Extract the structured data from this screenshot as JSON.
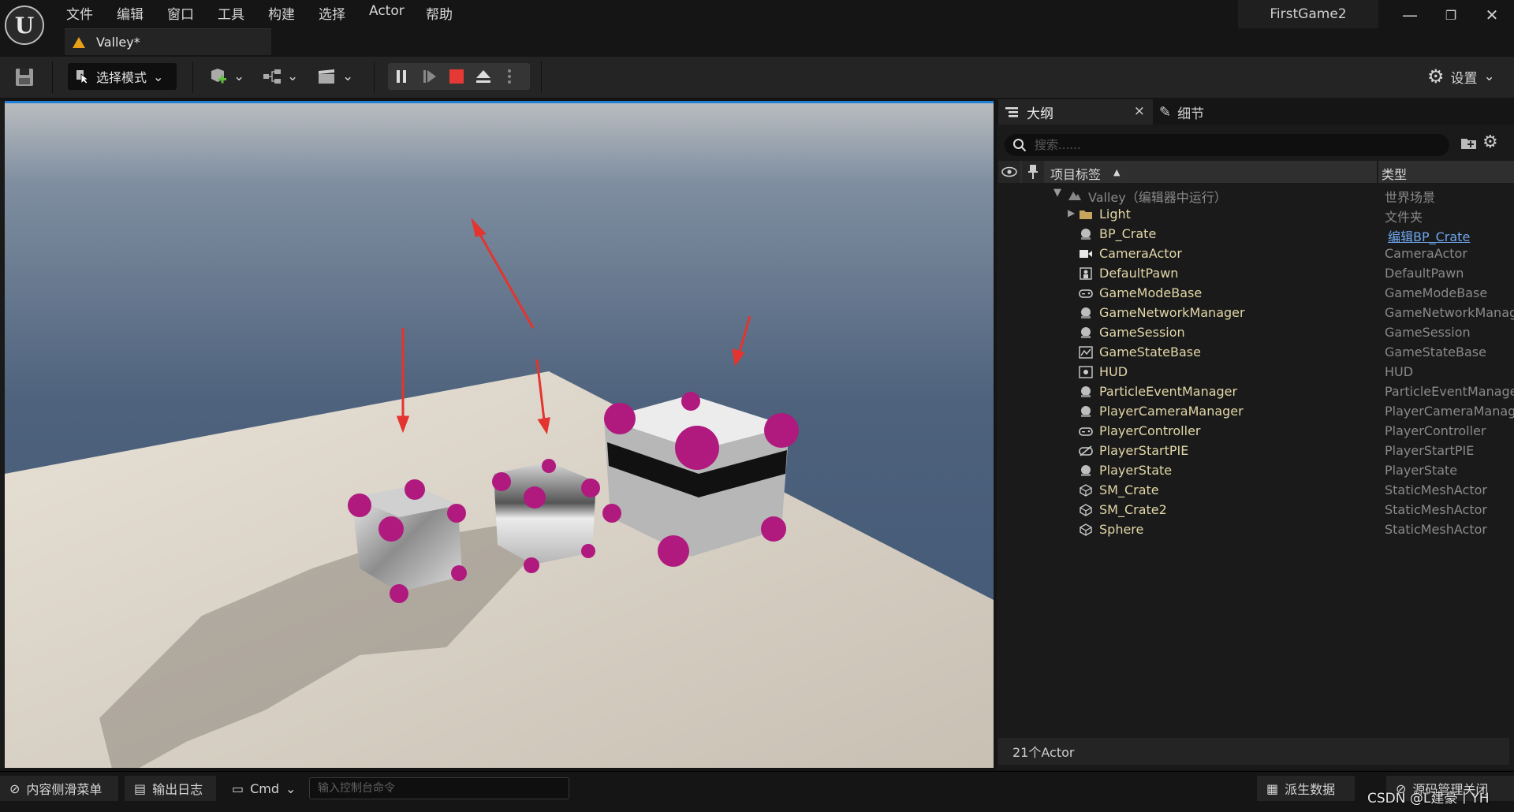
{
  "app": {
    "project_title": "FirstGame2",
    "logo_letter": "U",
    "menu": [
      "文件",
      "编辑",
      "窗口",
      "工具",
      "构建",
      "选择",
      "Actor",
      "帮助"
    ],
    "window_controls": {
      "minimize": "—",
      "restore": "❐",
      "close": "✕"
    }
  },
  "level_tab": {
    "label": "Valley*"
  },
  "toolbar": {
    "mode_label": "选择模式",
    "settings_label": "设置"
  },
  "outliner": {
    "tab_label": "大纲",
    "tab_close": "×",
    "details_tab_label": "细节",
    "search_placeholder": "搜索......",
    "col_label": "项目标签",
    "col_sort_arrow": "▲",
    "col_type": "类型",
    "root": {
      "label": "Valley（编辑器中运行）",
      "type": "世界场景"
    },
    "items": [
      {
        "label": "Light",
        "type": "文件夹",
        "icon": "folder-icon"
      },
      {
        "label": "BP_Crate",
        "type": "编辑BP_Crate",
        "icon": "actor-sphere-icon",
        "type_link": true
      },
      {
        "label": "CameraActor",
        "type": "CameraActor",
        "icon": "camera-icon"
      },
      {
        "label": "DefaultPawn",
        "type": "DefaultPawn",
        "icon": "pawn-icon"
      },
      {
        "label": "GameModeBase",
        "type": "GameModeBase",
        "icon": "gamepad-icon"
      },
      {
        "label": "GameNetworkManager",
        "type": "GameNetworkManager",
        "icon": "actor-sphere-icon"
      },
      {
        "label": "GameSession",
        "type": "GameSession",
        "icon": "actor-sphere-icon"
      },
      {
        "label": "GameStateBase",
        "type": "GameStateBase",
        "icon": "graph-icon"
      },
      {
        "label": "HUD",
        "type": "HUD",
        "icon": "hud-icon"
      },
      {
        "label": "ParticleEventManager",
        "type": "ParticleEventManager",
        "icon": "actor-sphere-icon"
      },
      {
        "label": "PlayerCameraManager",
        "type": "PlayerCameraManager",
        "icon": "actor-sphere-icon"
      },
      {
        "label": "PlayerController",
        "type": "PlayerController",
        "icon": "gamepad-icon"
      },
      {
        "label": "PlayerStartPIE",
        "type": "PlayerStartPIE",
        "icon": "player-start-icon"
      },
      {
        "label": "PlayerState",
        "type": "PlayerState",
        "icon": "actor-sphere-icon"
      },
      {
        "label": "SM_Crate",
        "type": "StaticMeshActor",
        "icon": "static-mesh-icon"
      },
      {
        "label": "SM_Crate2",
        "type": "StaticMeshActor",
        "icon": "static-mesh-icon"
      },
      {
        "label": "Sphere",
        "type": "StaticMeshActor",
        "icon": "static-mesh-icon"
      }
    ],
    "actor_count": "21个Actor"
  },
  "statusbar": {
    "content_drawer": "内容侧滑菜单",
    "output_log": "输出日志",
    "cmd_label": "Cmd",
    "cmd_placeholder": "输入控制台命令",
    "derived_data": "派生数据",
    "source_control": "源码管理关闭"
  },
  "watermark": "CSDN @L建豪丨YH",
  "colors": {
    "accent": "#1f7fd6",
    "play_stop": "#e53935",
    "crate_corner": "#b0197e",
    "label_text": "#e2d7a8"
  }
}
